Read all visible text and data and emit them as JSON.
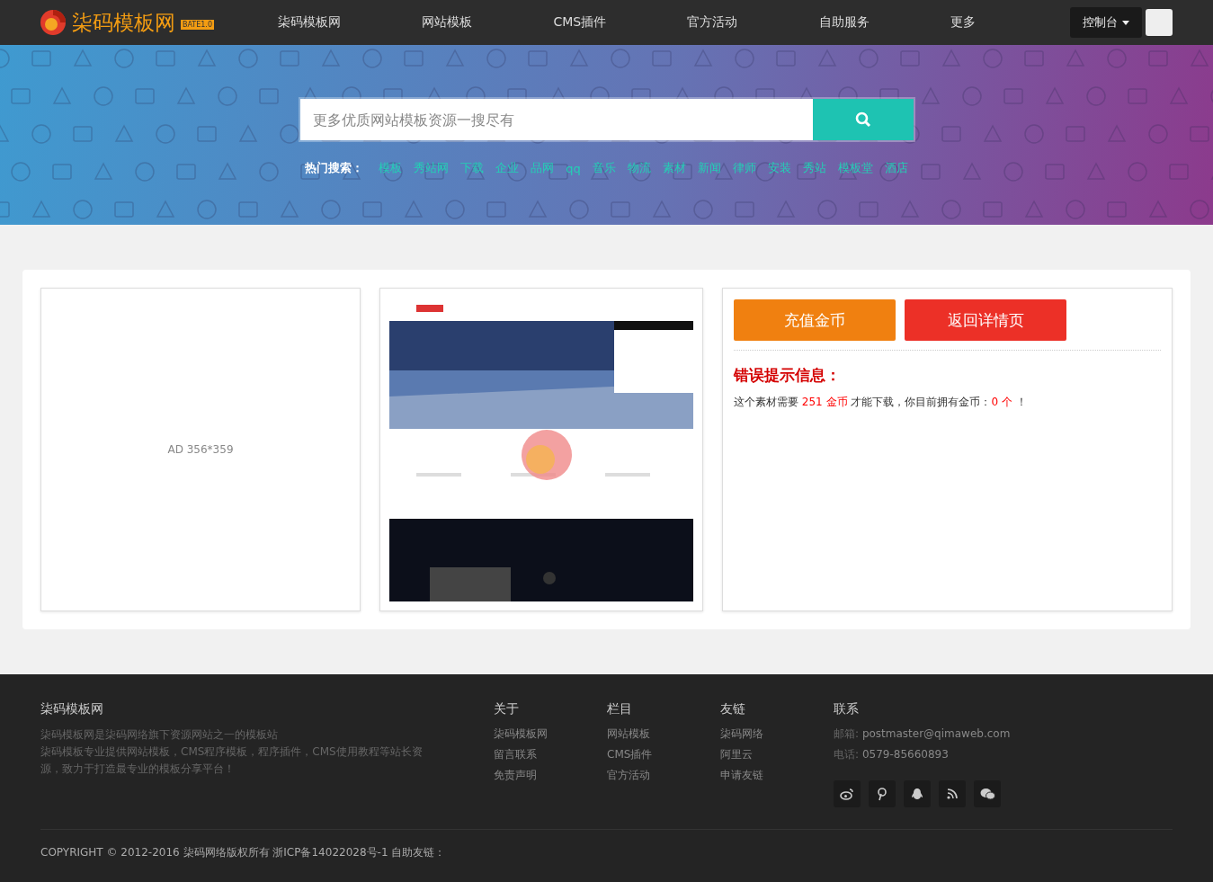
{
  "header": {
    "logo": "柒码模板网",
    "badge": "BATE1.0",
    "nav": [
      "柒码模板网",
      "网站模板",
      "CMS插件",
      "官方活动",
      "自助服务",
      "更多"
    ],
    "console": "控制台"
  },
  "banner": {
    "search": {
      "placeholder": "更多优质网站模板资源一搜尽有"
    },
    "hot_label": "热门搜索：",
    "hot_words": [
      "模板",
      "秀站网",
      "下载",
      "企业",
      "品网",
      "qq",
      "音乐",
      "物流",
      "素材",
      "新闻",
      "律师",
      "安装",
      "秀站",
      "模板堂",
      "酒店"
    ]
  },
  "ad": {
    "text": "AD 356*359"
  },
  "actions": {
    "buttons": [
      {
        "label": "充值金币",
        "kind": "recharge"
      },
      {
        "label": "返回详情页",
        "kind": "back"
      }
    ],
    "error_title": "错误提示信息：",
    "message": [
      {
        "text": "这个素材需要 ",
        "highlight": false
      },
      {
        "text": "251 金币",
        "highlight": true
      },
      {
        "text": " 才能下载，你目前拥有金币：",
        "highlight": false
      },
      {
        "text": "0 个",
        "highlight": true
      },
      {
        "text": " ！",
        "highlight": false
      }
    ]
  },
  "footer": {
    "brand": "柒码模板网",
    "description": [
      "柒码模板网是柒码网络旗下资源网站之一的模板站",
      "柒码模板专业提供网站模板，CMS程序模板，程序插件，CMS使用教程等站长资源，致力于打造最专业的模板分享平台！"
    ],
    "columns": [
      {
        "title": "关于",
        "links": [
          "柒码模板网",
          "留言联系",
          "免责声明"
        ]
      },
      {
        "title": "栏目",
        "links": [
          "网站模板",
          "CMS插件",
          "官方活动"
        ]
      },
      {
        "title": "友链",
        "links": [
          "柒码网络",
          "阿里云",
          "申请友链"
        ]
      }
    ],
    "contact": {
      "title": "联系",
      "lines": [
        {
          "label": "邮箱:",
          "value": "postmaster@qimaweb.com"
        },
        {
          "label": "电话:",
          "value": "0579-85660893"
        }
      ],
      "social": [
        {
          "kind": "weibo"
        },
        {
          "kind": "pinterest"
        },
        {
          "kind": "qq"
        },
        {
          "kind": "rss"
        },
        {
          "kind": "wechat"
        }
      ]
    },
    "copyright": "COPYRIGHT © 2012-2016 柒码网络版权所有 浙ICP备14022028号-1 自助友链："
  }
}
